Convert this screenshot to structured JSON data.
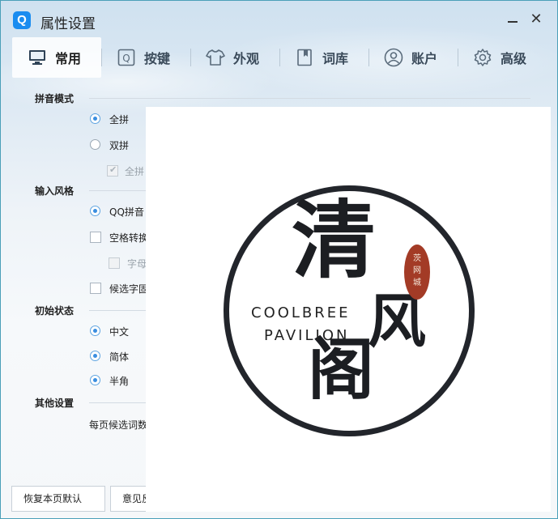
{
  "window": {
    "title": "属性设置",
    "app_icon_letter": "Q"
  },
  "tabs": [
    {
      "label": "常用",
      "icon": "monitor-icon"
    },
    {
      "label": "按键",
      "icon": "key-q-icon"
    },
    {
      "label": "外观",
      "icon": "tshirt-icon"
    },
    {
      "label": "词库",
      "icon": "book-icon"
    },
    {
      "label": "账户",
      "icon": "user-icon"
    },
    {
      "label": "高级",
      "icon": "gear-icon"
    }
  ],
  "sections": {
    "pinyin_mode": {
      "title": "拼音模式",
      "options": [
        {
          "label": "全拼",
          "type": "radio",
          "selected": true
        },
        {
          "label": "双拼",
          "type": "radio",
          "selected": false
        },
        {
          "label": "全拼",
          "type": "checkbox",
          "checked": true,
          "disabled": true
        }
      ]
    },
    "input_style": {
      "title": "输入风格",
      "options": [
        {
          "label": "QQ拼音",
          "type": "radio",
          "selected": true
        },
        {
          "label": "空格转换",
          "type": "checkbox",
          "checked": false
        },
        {
          "label": "字母",
          "type": "checkbox",
          "checked": false,
          "disabled": true
        },
        {
          "label": "候选字固",
          "type": "checkbox",
          "checked": false
        }
      ]
    },
    "initial_state": {
      "title": "初始状态",
      "options": [
        {
          "label": "中文",
          "type": "radio",
          "selected": true
        },
        {
          "label": "简体",
          "type": "radio",
          "selected": true
        },
        {
          "label": "半角",
          "type": "radio",
          "selected": true
        }
      ]
    },
    "other": {
      "title": "其他设置",
      "candidates_label": "每页候选词数"
    }
  },
  "overlay_logo": {
    "chars": [
      "清",
      "风",
      "阁"
    ],
    "latin_line1": "COOLBREE",
    "latin_line2": "PAVILION",
    "stamp_chars": [
      "茨",
      "网",
      "城"
    ]
  },
  "footer": {
    "restore_label": "恢复本页默认",
    "feedback_label": "意见反"
  }
}
